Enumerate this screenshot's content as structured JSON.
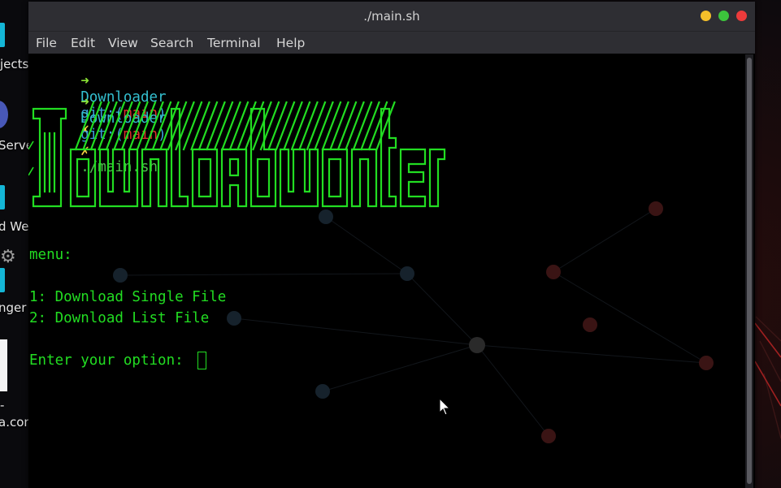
{
  "desktop": {
    "icons": [
      {
        "label": "jects"
      },
      {
        "label": "Serve"
      },
      {
        "label": "d We"
      },
      {
        "label": "nger"
      },
      {
        "label": "-"
      },
      {
        "label": "a.com."
      }
    ]
  },
  "window": {
    "title": "./main.sh",
    "controls": {
      "minimize": "#f5c02a",
      "maximize": "#3cc43c",
      "close": "#ec3b3b"
    }
  },
  "menubar": {
    "items": [
      "File",
      "Edit",
      "View",
      "Search",
      "Terminal",
      "Help"
    ]
  },
  "terminal": {
    "prompts": [
      {
        "arrow": "➜",
        "dir": "Downloader",
        "git": "git:(",
        "branch": "main",
        "git_close": ")",
        "dirty": "✗",
        "command": ""
      },
      {
        "arrow": "➜",
        "dir": "Downloader",
        "git": "git:(",
        "branch": "main",
        "git_close": ")",
        "dirty": "✗",
        "command": "./main.sh"
      }
    ],
    "banner_text": "DownloadMonster",
    "menu_header": "menu:",
    "options": [
      "1: Download Single File",
      "2: Download List File"
    ],
    "input_prompt": "Enter your option: "
  },
  "colors": {
    "terminal_green": "#22dd22",
    "prompt_cyan": "#34c0d0",
    "branch_red": "#e0302c"
  }
}
